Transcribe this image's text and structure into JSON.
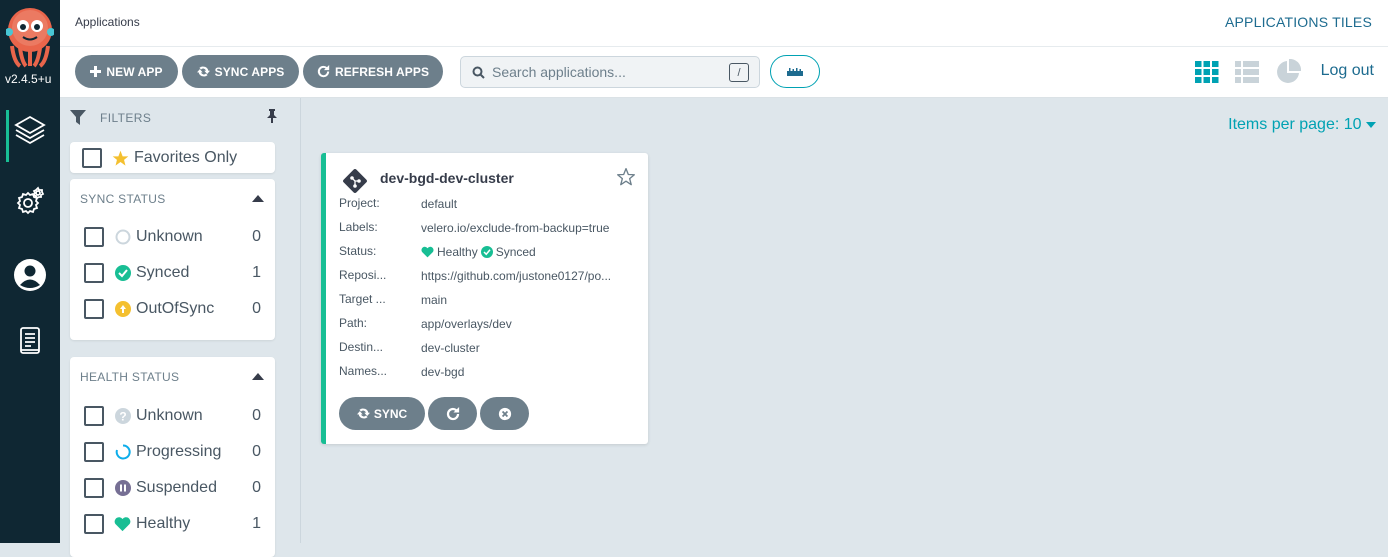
{
  "nav": {
    "version": "v2.4.5+u",
    "items": [
      {
        "icon": "layers-icon",
        "active": true
      },
      {
        "icon": "settings-gears-icon"
      },
      {
        "icon": "user-icon"
      },
      {
        "icon": "docs-icon"
      }
    ]
  },
  "topbar": {
    "breadcrumb": "Applications",
    "view_title": "APPLICATIONS TILES",
    "logout_label": "Log out"
  },
  "toolbar": {
    "new_app_label": "NEW APP",
    "sync_apps_label": "SYNC APPS",
    "refresh_apps_label": "REFRESH APPS",
    "search_placeholder": "Search applications...",
    "search_shortcut": "/"
  },
  "filters": {
    "header": "FILTERS",
    "favorites_label": "Favorites Only",
    "sync_status": {
      "title": "SYNC STATUS",
      "items": [
        {
          "label": "Unknown",
          "count": "0",
          "icon": "unknown-circle-icon"
        },
        {
          "label": "Synced",
          "count": "1",
          "icon": "synced-check-icon"
        },
        {
          "label": "OutOfSync",
          "count": "0",
          "icon": "out-of-sync-icon"
        }
      ]
    },
    "health_status": {
      "title": "HEALTH STATUS",
      "items": [
        {
          "label": "Unknown",
          "count": "0",
          "icon": "question-icon"
        },
        {
          "label": "Progressing",
          "count": "0",
          "icon": "progressing-icon"
        },
        {
          "label": "Suspended",
          "count": "0",
          "icon": "pause-icon"
        },
        {
          "label": "Healthy",
          "count": "1",
          "icon": "heart-icon"
        }
      ]
    }
  },
  "main": {
    "items_per_page": "Items per page: 10",
    "app": {
      "name": "dev-bgd-dev-cluster",
      "fields": [
        {
          "key": "Project:",
          "value": "default"
        },
        {
          "key": "Labels:",
          "value": "velero.io/exclude-from-backup=true"
        },
        {
          "key": "Status:",
          "health": "Healthy",
          "sync": "Synced"
        },
        {
          "key": "Reposi...",
          "value": "https://github.com/justone0127/po..."
        },
        {
          "key": "Target ...",
          "value": "main"
        },
        {
          "key": "Path:",
          "value": "app/overlays/dev"
        },
        {
          "key": "Destin...",
          "value": "dev-cluster"
        },
        {
          "key": "Names...",
          "value": "dev-bgd"
        }
      ],
      "sync_label": "SYNC"
    }
  },
  "colors": {
    "accent": "#00a2b3",
    "healthy": "#18be94",
    "outofsync": "#f4c030",
    "nav_bg": "#0f2733",
    "button": "#6d7f8b"
  }
}
